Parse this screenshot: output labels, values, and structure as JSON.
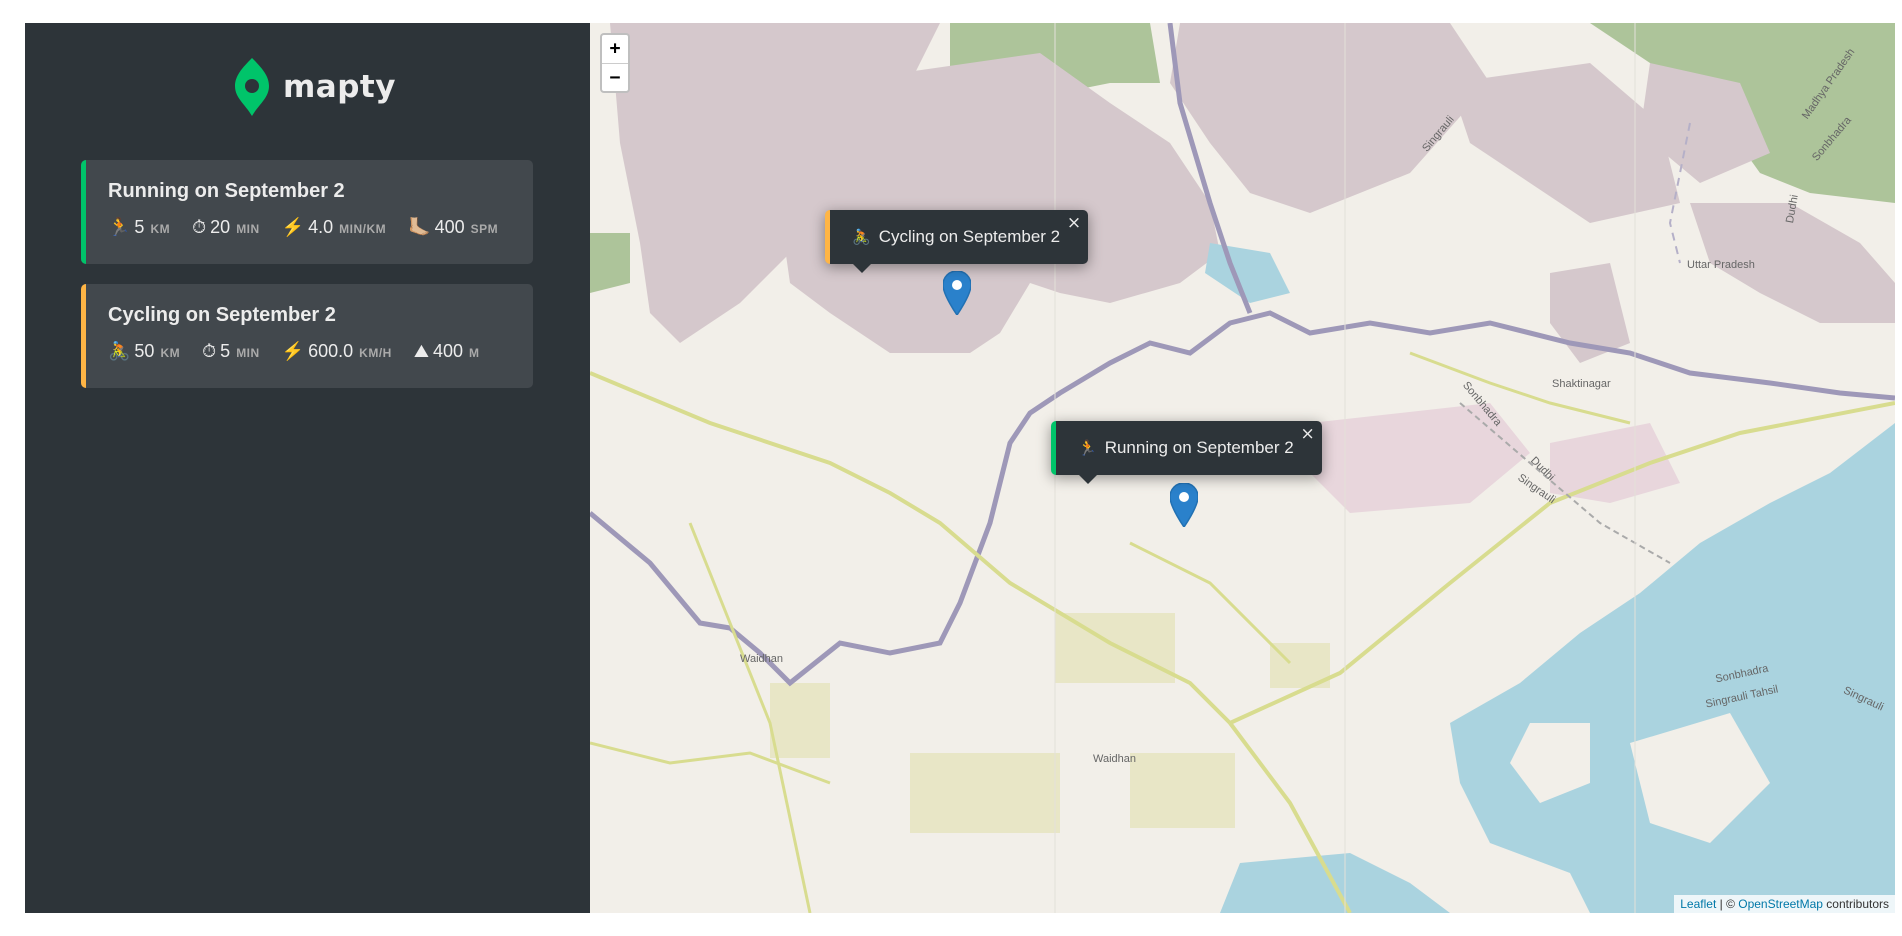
{
  "app": {
    "logo_text": "mapty",
    "brand_green": "#00c46a",
    "brand_yellow": "#ffb545"
  },
  "workouts": [
    {
      "type": "running",
      "title": "Running on September 2",
      "details": [
        {
          "icon": "🏃",
          "icon_name": "runner-icon",
          "value": "5",
          "unit": "km"
        },
        {
          "icon": "⏱",
          "icon_name": "stopwatch-icon",
          "value": "20",
          "unit": "min"
        },
        {
          "icon": "⚡️",
          "icon_name": "lightning-icon",
          "value": "4.0",
          "unit": "min/km"
        },
        {
          "icon": "🦶🏼",
          "icon_name": "foot-icon",
          "value": "400",
          "unit": "spm"
        }
      ]
    },
    {
      "type": "cycling",
      "title": "Cycling on September 2",
      "details": [
        {
          "icon": "🚴",
          "icon_name": "cyclist-icon",
          "value": "50",
          "unit": "km"
        },
        {
          "icon": "⏱",
          "icon_name": "stopwatch-icon",
          "value": "5",
          "unit": "min"
        },
        {
          "icon": "⚡️",
          "icon_name": "lightning-icon",
          "value": "600.0",
          "unit": "km/h"
        },
        {
          "icon": "⛰",
          "icon_name": "mountain-icon",
          "value": "400",
          "unit": "m"
        }
      ]
    }
  ],
  "map": {
    "zoom_in": "+",
    "zoom_out": "−",
    "popups": [
      {
        "type": "cycling",
        "icon": "🚴",
        "label": "Cycling on September 2",
        "close": "×"
      },
      {
        "type": "running",
        "icon": "🏃",
        "label": "Running on September 2",
        "close": "×"
      }
    ],
    "place_labels": [
      "Waidhan",
      "Waidhan",
      "Shaktinagar",
      "Uttar Pradesh",
      "Singrauli",
      "Sonbhadra",
      "Dudhi",
      "Singrauli",
      "Sonbhadra",
      "Singrauli Tahsil",
      "Singrauli",
      "Madhya Pradesh",
      "Sonbhadra",
      "Dudhi"
    ],
    "attribution": {
      "leaflet": "Leaflet",
      "sep": " | © ",
      "osm": "OpenStreetMap",
      "suffix": " contributors"
    },
    "colors": {
      "land": "#f2efe9",
      "military": "#d5c8cc",
      "forest": "#adc49a",
      "water": "#aad3df",
      "border": "#9e98b8",
      "road": "#d8dc8f",
      "industrial": "#e8d6dc"
    }
  }
}
